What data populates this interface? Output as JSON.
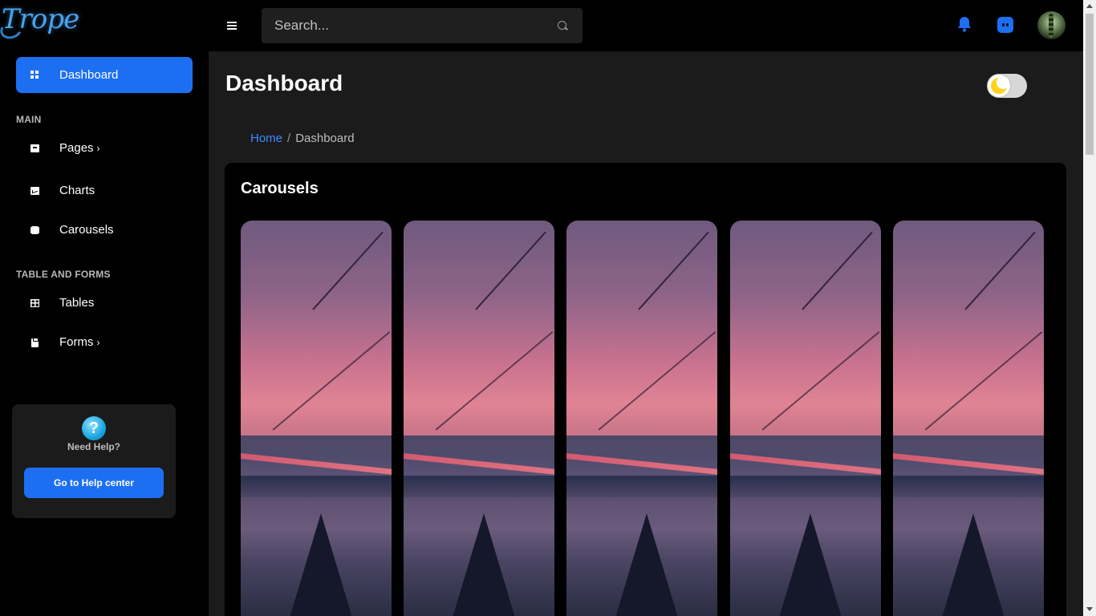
{
  "brand": {
    "logo_text": "Trope"
  },
  "sidebar": {
    "active_item": {
      "label": "Dashboard",
      "icon": "dashboard-icon"
    },
    "sections": [
      {
        "title": "MAIN"
      },
      {
        "title": "TABLE AND FORMS"
      }
    ],
    "items": [
      {
        "label": "Pages",
        "chevron": "›",
        "icon": "inbox-icon"
      },
      {
        "label": "Charts",
        "icon": "chart-icon"
      },
      {
        "label": "Carousels",
        "icon": "carousel-icon"
      },
      {
        "label": "Tables",
        "icon": "table-icon"
      },
      {
        "label": "Forms",
        "chevron": "›",
        "icon": "clipboard-icon"
      }
    ],
    "help": {
      "icon_glyph": "?",
      "title": "Need Help?",
      "button_label": "Go to Help center"
    }
  },
  "topbar": {
    "search_placeholder": "Search...",
    "icons": [
      "menu-icon",
      "search-icon",
      "bell-icon",
      "discord-icon",
      "avatar"
    ],
    "accent": "#1d6ff2"
  },
  "main": {
    "page_title": "Dashboard",
    "theme_toggle": "dark-mode-toggle",
    "breadcrumb": {
      "home": "Home",
      "separator": "/",
      "current": "Dashboard"
    },
    "card": {
      "title": "Carousels",
      "slide_count": 5
    }
  },
  "colors": {
    "sidebar_bg": "#000000",
    "content_bg": "#1b1b1b",
    "accent": "#1d6ff2",
    "link": "#3d8bff"
  }
}
